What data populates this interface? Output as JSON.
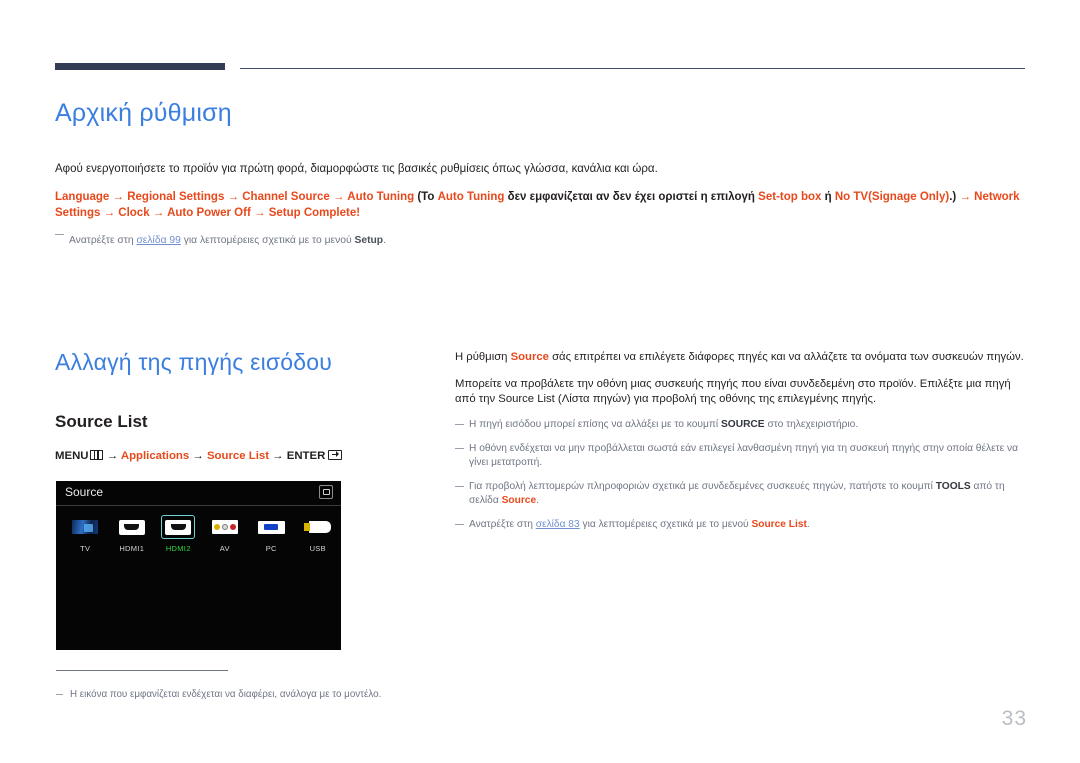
{
  "page": {
    "number": "33"
  },
  "section_initial_setup": {
    "title": "Αρχική ρύθμιση",
    "intro": "Αφού ενεργοποιήσετε το προϊόν για πρώτη φορά, διαμορφώστε τις βασικές ρυθμίσεις όπως γλώσσα, κανάλια και ώρα.",
    "path": {
      "p1": "Language",
      "arrow": "→",
      "p2": "Regional Settings",
      "p3": "Channel Source",
      "p4": "Auto Tuning",
      "paren_open": "(Το",
      "p5": "Auto Tuning",
      "mid_text": "δεν εμφανίζεται αν δεν έχει οριστεί η επιλογή",
      "p6": "Set-top box",
      "or": "ή",
      "p7": "No TV(Signage Only)",
      "paren_close": ".)",
      "p8": "Network Settings",
      "p9": "Clock",
      "p10": "Auto Power Off",
      "p11": "Setup Complete!"
    },
    "note": {
      "before": "Ανατρέξτε στη",
      "link": "σελίδα 99",
      "middle": "για λεπτομέρειες σχετικά με το μενού",
      "bold": "Setup",
      "after": "."
    }
  },
  "section_change_input": {
    "title": "Αλλαγή της πηγής εισόδου",
    "subtitle": "Source List",
    "menu_path": {
      "menu": "MENU",
      "menu_icon": "menu-grid-icon",
      "arrow": "→",
      "applications": "Applications",
      "source_list": "Source List",
      "enter": "ENTER",
      "enter_icon": "enter-key-icon"
    },
    "osd": {
      "title": "Source",
      "corner_icon": "screen-return-icon",
      "items": [
        {
          "label": "TV",
          "icon": "tv-screen-icon",
          "selected": false
        },
        {
          "label": "HDMI1",
          "icon": "hdmi-port-icon",
          "selected": false
        },
        {
          "label": "HDMI2",
          "icon": "hdmi-port-icon",
          "selected": true
        },
        {
          "label": "AV",
          "icon": "av-rca-icon",
          "selected": false
        },
        {
          "label": "PC",
          "icon": "vga-port-icon",
          "selected": false
        },
        {
          "label": "USB",
          "icon": "usb-plug-icon",
          "selected": false
        }
      ]
    },
    "image_note": "Η εικόνα που εμφανίζεται ενδέχεται να διαφέρει, ανάλογα με το μοντέλο.",
    "right": {
      "p1_a": "Η ρύθμιση",
      "p1_b": "Source",
      "p1_c": "σάς επιτρέπει να επιλέγετε διάφορες πηγές και να αλλάζετε τα ονόματα των συσκευών πηγών.",
      "p2": "Μπορείτε να προβάλετε την οθόνη μιας συσκευής πηγής που είναι συνδεδεμένη στο προϊόν. Επιλέξτε μια πηγή από την Source List (Λίστα πηγών) για προβολή της οθόνης της επιλεγμένης πηγής.",
      "note1_a": "Η πηγή εισόδου μπορεί επίσης να αλλάξει με το κουμπί",
      "note1_b": "SOURCE",
      "note1_c": "στο τηλεχειριστήριο.",
      "note2": "Η οθόνη ενδέχεται να μην προβάλλεται σωστά εάν επιλεγεί λανθασμένη πηγή για τη συσκευή πηγής στην οποία θέλετε να γίνει μετατροπή.",
      "note3_a": "Για προβολή λεπτομερών πληροφοριών σχετικά με συνδεδεμένες συσκευές πηγών, πατήστε το κουμπί",
      "note3_b": "TOOLS",
      "note3_c": "από τη σελίδα",
      "note3_d": "Source",
      "note3_e": ".",
      "note4_a": "Ανατρέξτε στη",
      "note4_link": "σελίδα 83",
      "note4_b": "για λεπτομέρειες σχετικά με το μενού",
      "note4_c": "Source List",
      "note4_d": "."
    }
  },
  "colors": {
    "accent_blue": "#3a7fe0",
    "accent_orange": "#e8491c",
    "header_navy": "#333b55",
    "note_gray": "#6f7584",
    "selected_green": "#2fd53f",
    "selection_border": "#6fd3d3"
  }
}
